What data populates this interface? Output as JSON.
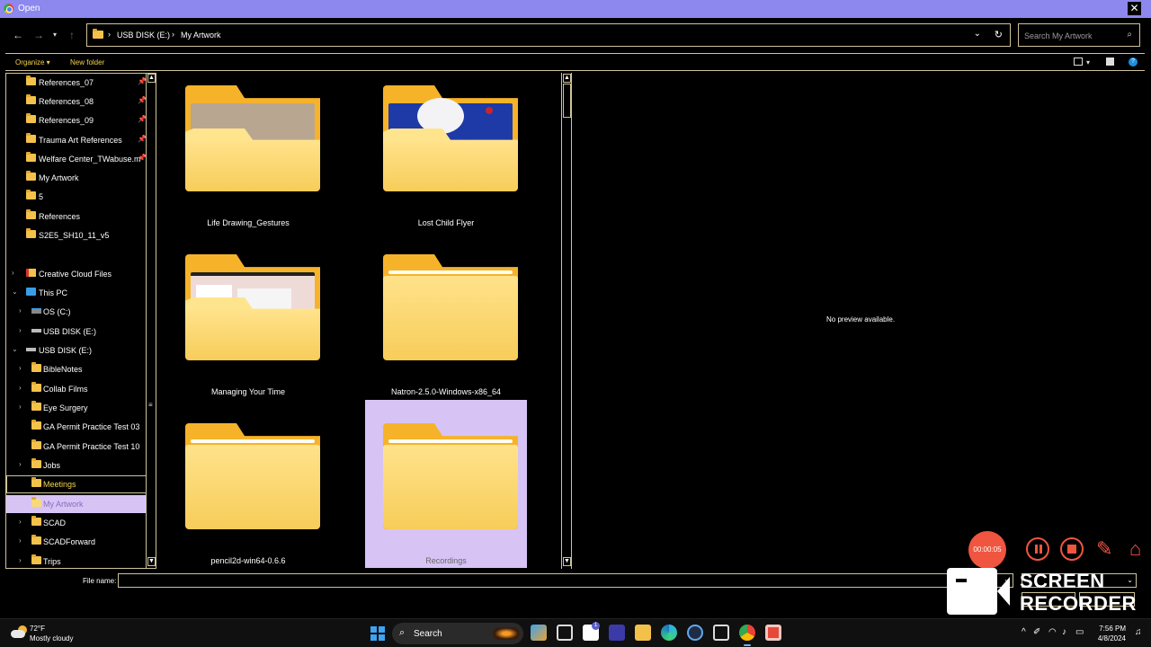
{
  "window": {
    "title": "Open"
  },
  "nav": {
    "back_icon": "arrow-left",
    "forward_icon": "arrow-right",
    "recent_icon": "chevron-down",
    "up_icon": "arrow-up",
    "breadcrumb": [
      "USB DISK (E:)",
      "My Artwork"
    ],
    "separator": "›",
    "search_placeholder": "Search My Artwork"
  },
  "toolbar": {
    "organize_label": "Organize ▾",
    "new_folder_label": "New folder",
    "help_label": "?"
  },
  "sidebar": {
    "quick_access": [
      {
        "label": "References_07",
        "pinned": true
      },
      {
        "label": "References_08",
        "pinned": true
      },
      {
        "label": "References_09",
        "pinned": true
      },
      {
        "label": "Trauma Art References",
        "pinned": true
      },
      {
        "label": "Welfare Center_TWabuse.m",
        "pinned": true
      },
      {
        "label": "My Artwork",
        "pinned": false
      },
      {
        "label": "5",
        "pinned": false
      },
      {
        "label": "References",
        "pinned": false
      },
      {
        "label": "S2E5_SH10_11_v5",
        "pinned": false
      }
    ],
    "tree": [
      {
        "label": "Creative Cloud Files",
        "icon": "creative-cloud-icon"
      },
      {
        "label": "This PC",
        "icon": "pc-icon"
      },
      {
        "label": "OS (C:)",
        "icon": "drive-icon"
      },
      {
        "label": "USB DISK (E:)",
        "icon": "usb-drive-icon"
      },
      {
        "label": "USB DISK (E:)",
        "icon": "usb-drive-icon"
      },
      {
        "label": "BibleNotes",
        "icon": "folder-icon"
      },
      {
        "label": "Collab Films",
        "icon": "folder-icon"
      },
      {
        "label": "Eye Surgery",
        "icon": "folder-icon"
      },
      {
        "label": "GA Permit Practice Test 03",
        "icon": "folder-icon"
      },
      {
        "label": "GA Permit Practice Test 10",
        "icon": "folder-icon"
      },
      {
        "label": "Jobs",
        "icon": "folder-icon"
      },
      {
        "label": "Meetings",
        "icon": "folder-icon"
      },
      {
        "label": "My Artwork",
        "icon": "folder-icon"
      },
      {
        "label": "SCAD",
        "icon": "folder-icon"
      },
      {
        "label": "SCADForward",
        "icon": "folder-icon"
      },
      {
        "label": "Trips",
        "icon": "folder-icon"
      }
    ]
  },
  "files": [
    {
      "name": "Life Drawing_Gestures",
      "thumb": "tan-paper"
    },
    {
      "name": "Lost Child  Flyer",
      "thumb": "blue-flyer"
    },
    {
      "name": "Managing Your Time",
      "thumb": "screenshot"
    },
    {
      "name": "Natron-2.5.0-Windows-x86_64",
      "thumb": "empty"
    },
    {
      "name": "pencil2d-win64-0.6.6",
      "thumb": "empty"
    },
    {
      "name": "Recordings",
      "thumb": "empty",
      "selected": true
    }
  ],
  "preview": {
    "message": "No preview available."
  },
  "filename": {
    "label": "File name:",
    "value": ""
  },
  "recorder": {
    "timer": "00:00:05",
    "brand_line1": "SCREEN",
    "brand_line2": "RECORDER"
  },
  "taskbar": {
    "temperature": "72°F",
    "weather": "Mostly cloudy",
    "search_label": "Search",
    "time": "7:56 PM",
    "date": "4/8/2024",
    "teams_badge": "1"
  },
  "colors": {
    "accent_border": "#cfc39a",
    "titlebar": "#8c88ee",
    "selection": "#d7c4f5",
    "folder": "#f6b32a",
    "recorder": "#f0553f",
    "toolbar_text": "#f3d34a"
  }
}
